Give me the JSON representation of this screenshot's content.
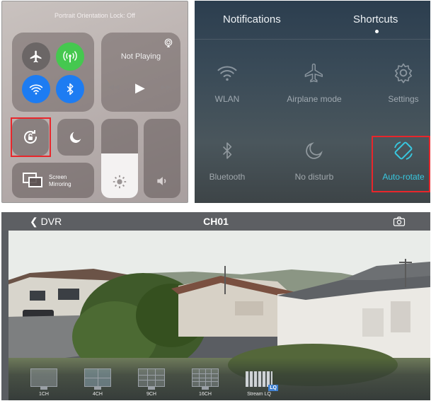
{
  "ios_control_center": {
    "orientation_lock_status": "Portrait Orientation Lock: Off",
    "media_status": "Not Playing",
    "screen_mirroring_label": "Screen\nMirroring"
  },
  "android_shortcuts": {
    "tabs": [
      {
        "label": "Notifications"
      },
      {
        "label": "Shortcuts"
      }
    ],
    "items": [
      {
        "label": "WLAN",
        "icon": "wifi-icon"
      },
      {
        "label": "Airplane mode",
        "icon": "airplane-icon"
      },
      {
        "label": "Settings",
        "icon": "gear-icon"
      },
      {
        "label": "Bluetooth",
        "icon": "bluetooth-icon"
      },
      {
        "label": "No disturb",
        "icon": "moon-icon"
      },
      {
        "label": "Auto-rotate",
        "icon": "rotate-icon"
      }
    ],
    "active_color": "#38c8e0",
    "highlight_color": "#e8262b"
  },
  "dvr": {
    "back_label": "DVR",
    "channel_title": "CH01",
    "modes": [
      {
        "label": "1CH"
      },
      {
        "label": "4CH"
      },
      {
        "label": "9CH"
      },
      {
        "label": "16CH"
      },
      {
        "label": "Stream LQ",
        "badge": "LQ"
      }
    ]
  }
}
